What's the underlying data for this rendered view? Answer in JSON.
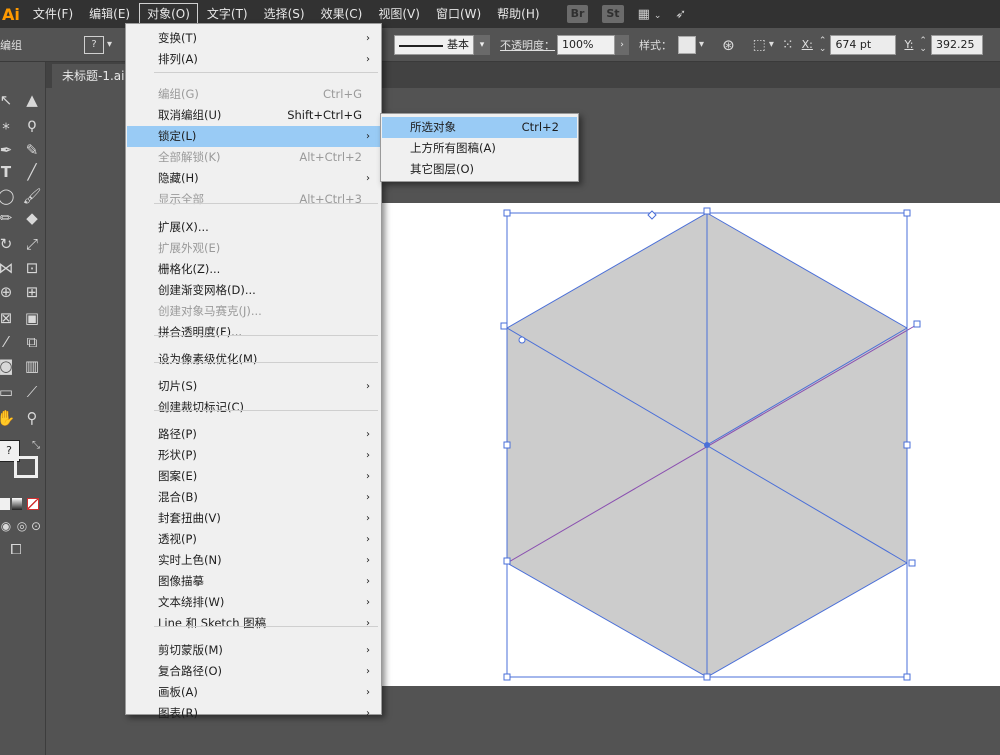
{
  "app": {
    "logo": "Ai"
  },
  "menubar": {
    "items": [
      "文件(F)",
      "编辑(E)",
      "对象(O)",
      "文字(T)",
      "选择(S)",
      "效果(C)",
      "视图(V)",
      "窗口(W)",
      "帮助(H)"
    ],
    "active_index": 2,
    "bridge_label": "Br",
    "stock_label": "St"
  },
  "control_bar": {
    "left_label": "编组",
    "stroke_style_label": "基本",
    "opacity_label": "不透明度：",
    "opacity_value": "100%",
    "style_label": "样式：",
    "x_label": "X:",
    "x_value": "674 pt",
    "y_label": "Y:",
    "y_value": "392.25"
  },
  "document": {
    "tab_title": "未标题-1.ai*"
  },
  "object_menu": {
    "items": [
      {
        "label": "变换(T)",
        "shortcut": "",
        "submenu": true,
        "disabled": false
      },
      {
        "label": "排列(A)",
        "shortcut": "",
        "submenu": true,
        "disabled": false
      },
      {
        "label": "编组(G)",
        "shortcut": "Ctrl+G",
        "submenu": false,
        "disabled": true
      },
      {
        "label": "取消编组(U)",
        "shortcut": "Shift+Ctrl+G",
        "submenu": false,
        "disabled": false
      },
      {
        "label": "锁定(L)",
        "shortcut": "",
        "submenu": true,
        "disabled": false,
        "highlighted": true
      },
      {
        "label": "全部解锁(K)",
        "shortcut": "Alt+Ctrl+2",
        "submenu": false,
        "disabled": true
      },
      {
        "label": "隐藏(H)",
        "shortcut": "",
        "submenu": true,
        "disabled": false
      },
      {
        "label": "显示全部",
        "shortcut": "Alt+Ctrl+3",
        "submenu": false,
        "disabled": true
      },
      {
        "label": "扩展(X)...",
        "shortcut": "",
        "submenu": false,
        "disabled": false
      },
      {
        "label": "扩展外观(E)",
        "shortcut": "",
        "submenu": false,
        "disabled": true
      },
      {
        "label": "栅格化(Z)...",
        "shortcut": "",
        "submenu": false,
        "disabled": false
      },
      {
        "label": "创建渐变网格(D)...",
        "shortcut": "",
        "submenu": false,
        "disabled": false
      },
      {
        "label": "创建对象马赛克(J)...",
        "shortcut": "",
        "submenu": false,
        "disabled": true
      },
      {
        "label": "拼合透明度(F)...",
        "shortcut": "",
        "submenu": false,
        "disabled": false
      },
      {
        "label": "设为像素级优化(M)",
        "shortcut": "",
        "submenu": false,
        "disabled": false
      },
      {
        "label": "切片(S)",
        "shortcut": "",
        "submenu": true,
        "disabled": false
      },
      {
        "label": "创建裁切标记(C)",
        "shortcut": "",
        "submenu": false,
        "disabled": false
      },
      {
        "label": "路径(P)",
        "shortcut": "",
        "submenu": true,
        "disabled": false
      },
      {
        "label": "形状(P)",
        "shortcut": "",
        "submenu": true,
        "disabled": false
      },
      {
        "label": "图案(E)",
        "shortcut": "",
        "submenu": true,
        "disabled": false
      },
      {
        "label": "混合(B)",
        "shortcut": "",
        "submenu": true,
        "disabled": false
      },
      {
        "label": "封套扭曲(V)",
        "shortcut": "",
        "submenu": true,
        "disabled": false
      },
      {
        "label": "透视(P)",
        "shortcut": "",
        "submenu": true,
        "disabled": false
      },
      {
        "label": "实时上色(N)",
        "shortcut": "",
        "submenu": true,
        "disabled": false
      },
      {
        "label": "图像描摹",
        "shortcut": "",
        "submenu": true,
        "disabled": false
      },
      {
        "label": "文本绕排(W)",
        "shortcut": "",
        "submenu": true,
        "disabled": false
      },
      {
        "label": "Line 和 Sketch 图稿",
        "shortcut": "",
        "submenu": true,
        "disabled": false
      },
      {
        "label": "剪切蒙版(M)",
        "shortcut": "",
        "submenu": true,
        "disabled": false
      },
      {
        "label": "复合路径(O)",
        "shortcut": "",
        "submenu": true,
        "disabled": false
      },
      {
        "label": "画板(A)",
        "shortcut": "",
        "submenu": true,
        "disabled": false
      },
      {
        "label": "图表(R)",
        "shortcut": "",
        "submenu": true,
        "disabled": false
      }
    ]
  },
  "lock_submenu": {
    "items": [
      {
        "label": "所选对象",
        "shortcut": "Ctrl+2",
        "highlighted": true
      },
      {
        "label": "上方所有图稿(A)",
        "shortcut": ""
      },
      {
        "label": "其它图层(O)",
        "shortcut": ""
      }
    ]
  },
  "colors": {
    "menubar_bg": "#323232",
    "ui_bg": "#535353",
    "menu_bg": "#f0f0f0",
    "menu_highlight": "#99cbf5",
    "hexagon_fill": "#cccccc",
    "selection_blue": "#4a6fd8",
    "diagonal_purple": "#8a4fb0",
    "logo_orange": "#ff9a00"
  }
}
